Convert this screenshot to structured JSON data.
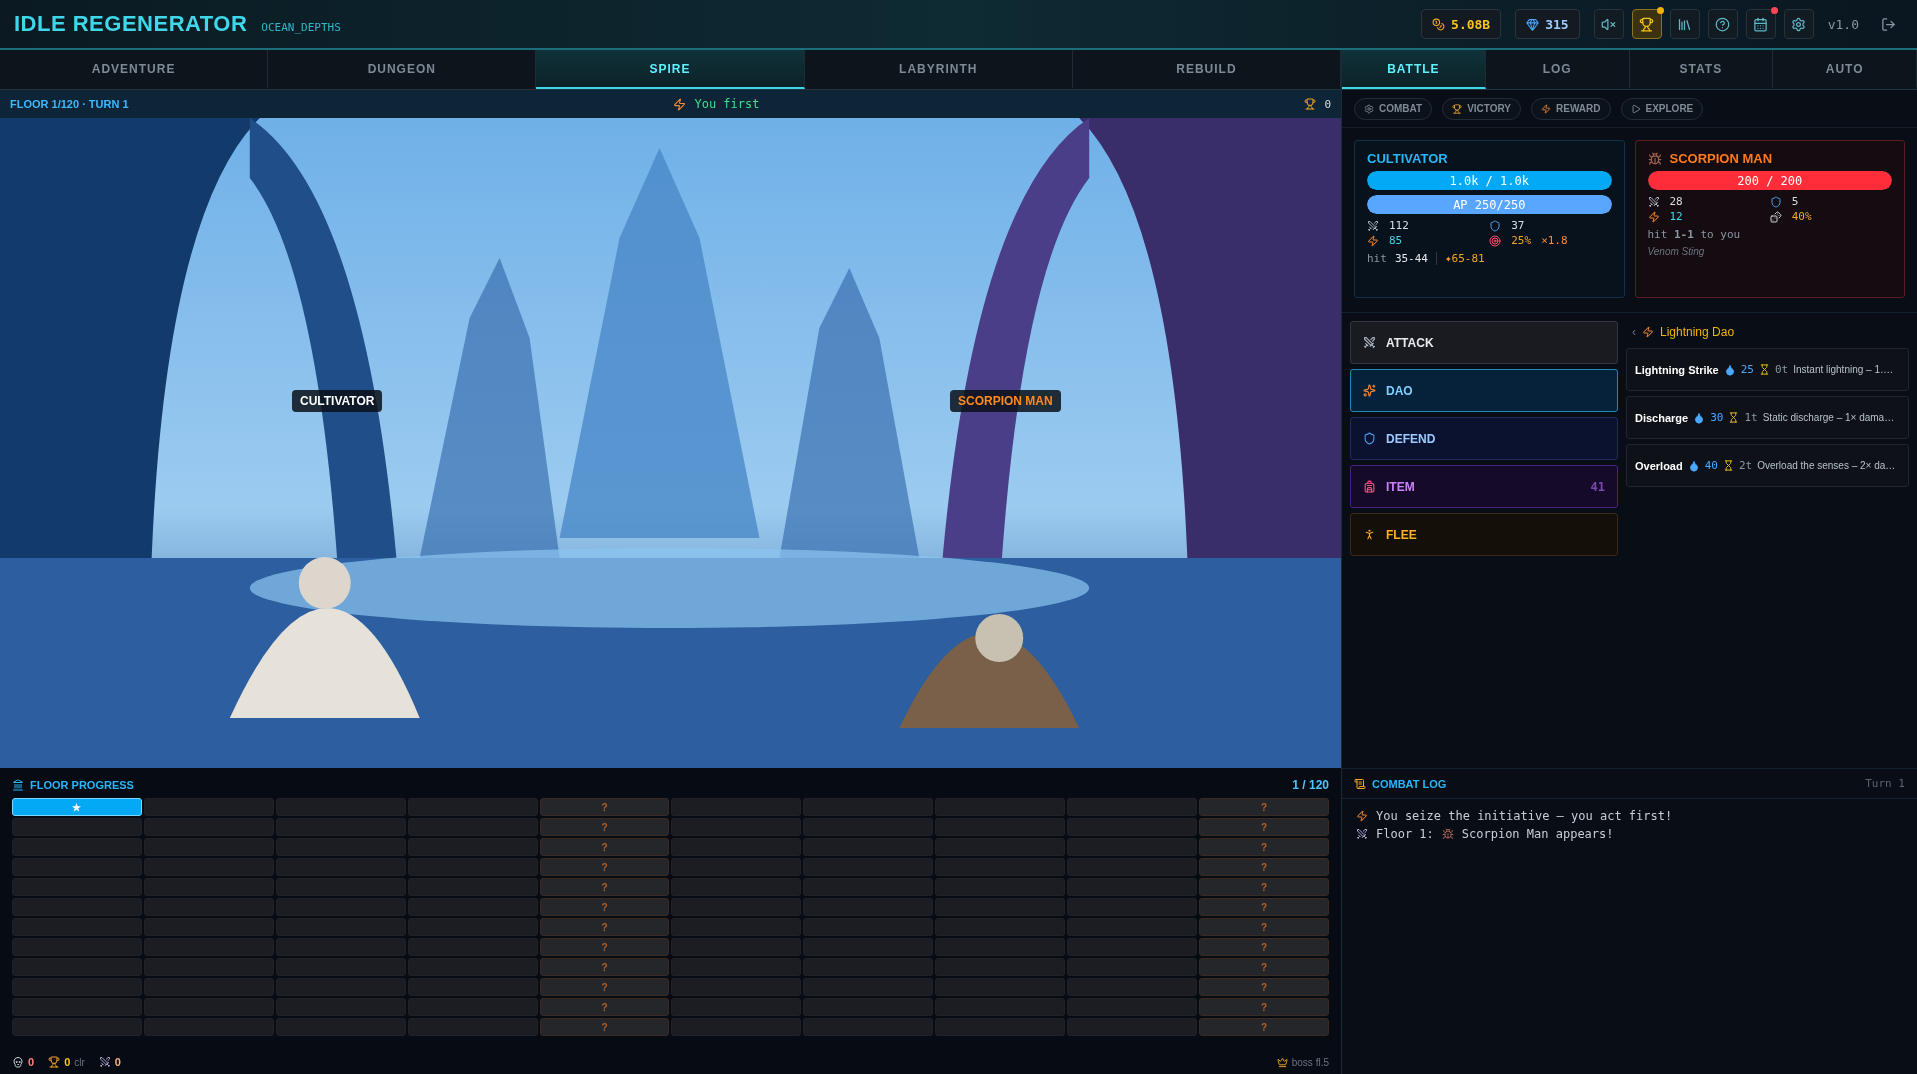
{
  "app": {
    "title": "IDLE REGENERATOR",
    "subtitle": "OCEAN_DEPTHS",
    "version": "v1.0"
  },
  "currencies": [
    {
      "kind": "gold",
      "value": "5.08B"
    },
    {
      "kind": "gem",
      "value": "315"
    }
  ],
  "toolbar": [
    {
      "kind": "mute",
      "selected": false
    },
    {
      "kind": "trophy",
      "selected": true,
      "color": "#f5b000"
    },
    {
      "kind": "library",
      "selected": false
    },
    {
      "kind": "help",
      "selected": false
    },
    {
      "kind": "calendar",
      "selected": false,
      "color": "#ff4455"
    },
    {
      "kind": "settings",
      "selected": false
    }
  ],
  "main_tabs": [
    {
      "label": "ADVENTURE",
      "selected": false
    },
    {
      "label": "DUNGEON",
      "selected": false
    },
    {
      "label": "SPIRE",
      "selected": true
    },
    {
      "label": "LABYRINTH",
      "selected": false
    },
    {
      "label": "REBUILD",
      "selected": false
    }
  ],
  "side_tabs": [
    {
      "label": "BATTLE",
      "selected": true
    },
    {
      "label": "LOG",
      "selected": false
    },
    {
      "label": "STATS",
      "selected": false
    },
    {
      "label": "AUTO",
      "selected": false
    }
  ],
  "scene": {
    "floor_label": "FLOOR 1/120 · TURN 1",
    "initiative": "You first",
    "trophies": "0",
    "fighters": [
      {
        "name": "CULTIVATOR",
        "kind": "ally"
      },
      {
        "name": "SCORPION MAN",
        "kind": "enemy"
      }
    ]
  },
  "filters": [
    {
      "kind": "combat",
      "label": "COMBAT"
    },
    {
      "kind": "victory",
      "label": "VICTORY"
    },
    {
      "kind": "reward",
      "label": "REWARD"
    },
    {
      "kind": "explore",
      "label": "EXPLORE"
    }
  ],
  "player": {
    "name": "CULTIVATOR",
    "hp": {
      "text": "1.0k / 1.0k",
      "level": 1
    },
    "ap": {
      "text": "AP 250/250",
      "level": 1
    },
    "stats": [
      {
        "kind": "attack",
        "value": "112"
      },
      {
        "kind": "defense",
        "value": "37"
      },
      {
        "kind": "speed",
        "value": "85"
      },
      {
        "kind": "crit",
        "value": "25%",
        "extra": "×1.8"
      }
    ],
    "hit_label": "hit",
    "hit": "35-44",
    "special": "✦65-81"
  },
  "enemy": {
    "name": "SCORPION MAN",
    "hp": {
      "text": "200 / 200",
      "level": 1
    },
    "stats": [
      {
        "kind": "attack",
        "value": "28"
      },
      {
        "kind": "defense",
        "value": "5"
      },
      {
        "kind": "speed",
        "value": "12"
      },
      {
        "kind": "dodge",
        "value": "40%"
      }
    ],
    "hit_text": "hit **1-1** to you",
    "ability": "Venom Sting"
  },
  "actions": [
    {
      "kind": "attack",
      "label": "ATTACK",
      "selected": false
    },
    {
      "kind": "dao",
      "label": "DAO",
      "selected": true
    },
    {
      "kind": "defend",
      "label": "DEFEND",
      "selected": false
    },
    {
      "kind": "item",
      "label": "ITEM",
      "selected": false,
      "count": "41"
    },
    {
      "kind": "flee",
      "label": "FLEE",
      "selected": false
    }
  ],
  "skills": {
    "back": "‹",
    "title": "Lightning Dao",
    "items": [
      {
        "name": "Lightning Strike",
        "cost": "25",
        "cooldown": "0t",
        "desc": "Instant lightning – 1…."
      },
      {
        "name": "Discharge",
        "cost": "30",
        "cooldown": "1t",
        "desc": "Static discharge – 1× dama…"
      },
      {
        "name": "Overload",
        "cost": "40",
        "cooldown": "2t",
        "desc": "Overload the senses – 2× da…"
      }
    ]
  },
  "progress": {
    "title": "FLOOR PROGRESS",
    "count": "1 / 120",
    "cells": [
      {
        "kind": "current",
        "label": "★"
      },
      {
        "kind": "plain"
      },
      {
        "kind": "plain"
      },
      {
        "kind": "plain"
      },
      {
        "kind": "boss",
        "label": "?"
      },
      {
        "kind": "plain"
      },
      {
        "kind": "plain"
      },
      {
        "kind": "plain"
      },
      {
        "kind": "plain"
      },
      {
        "kind": "boss",
        "label": "?"
      },
      {
        "kind": "plain"
      },
      {
        "kind": "plain"
      },
      {
        "kind": "plain"
      },
      {
        "kind": "plain"
      },
      {
        "kind": "boss",
        "label": "?"
      },
      {
        "kind": "plain"
      },
      {
        "kind": "plain"
      },
      {
        "kind": "plain"
      },
      {
        "kind": "plain"
      },
      {
        "kind": "boss",
        "label": "?"
      },
      {
        "kind": "plain"
      },
      {
        "kind": "plain"
      },
      {
        "kind": "plain"
      },
      {
        "kind": "plain"
      },
      {
        "kind": "boss",
        "label": "?"
      },
      {
        "kind": "plain"
      },
      {
        "kind": "plain"
      },
      {
        "kind": "plain"
      },
      {
        "kind": "plain"
      },
      {
        "kind": "boss",
        "label": "?"
      },
      {
        "kind": "plain"
      },
      {
        "kind": "plain"
      },
      {
        "kind": "plain"
      },
      {
        "kind": "plain"
      },
      {
        "kind": "boss",
        "label": "?"
      },
      {
        "kind": "plain"
      },
      {
        "kind": "plain"
      },
      {
        "kind": "plain"
      },
      {
        "kind": "plain"
      },
      {
        "kind": "boss",
        "label": "?"
      },
      {
        "kind": "plain"
      },
      {
        "kind": "plain"
      },
      {
        "kind": "plain"
      },
      {
        "kind": "plain"
      },
      {
        "kind": "boss",
        "label": "?"
      },
      {
        "kind": "plain"
      },
      {
        "kind": "plain"
      },
      {
        "kind": "plain"
      },
      {
        "kind": "plain"
      },
      {
        "kind": "boss",
        "label": "?"
      },
      {
        "kind": "plain"
      },
      {
        "kind": "plain"
      },
      {
        "kind": "plain"
      },
      {
        "kind": "plain"
      },
      {
        "kind": "boss",
        "label": "?"
      },
      {
        "kind": "plain"
      },
      {
        "kind": "plain"
      },
      {
        "kind": "plain"
      },
      {
        "kind": "plain"
      },
      {
        "kind": "boss",
        "label": "?"
      },
      {
        "kind": "plain"
      },
      {
        "kind": "plain"
      },
      {
        "kind": "plain"
      },
      {
        "kind": "plain"
      },
      {
        "kind": "boss",
        "label": "?"
      },
      {
        "kind": "plain"
      },
      {
        "kind": "plain"
      },
      {
        "kind": "plain"
      },
      {
        "kind": "plain"
      },
      {
        "kind": "boss",
        "label": "?"
      },
      {
        "kind": "plain"
      },
      {
        "kind": "plain"
      },
      {
        "kind": "plain"
      },
      {
        "kind": "plain"
      },
      {
        "kind": "boss",
        "label": "?"
      },
      {
        "kind": "plain"
      },
      {
        "kind": "plain"
      },
      {
        "kind": "plain"
      },
      {
        "kind": "plain"
      },
      {
        "kind": "boss",
        "label": "?"
      },
      {
        "kind": "plain"
      },
      {
        "kind": "plain"
      },
      {
        "kind": "plain"
      },
      {
        "kind": "plain"
      },
      {
        "kind": "boss",
        "label": "?"
      },
      {
        "kind": "plain"
      },
      {
        "kind": "plain"
      },
      {
        "kind": "plain"
      },
      {
        "kind": "plain"
      },
      {
        "kind": "boss",
        "label": "?"
      },
      {
        "kind": "plain"
      },
      {
        "kind": "plain"
      },
      {
        "kind": "plain"
      },
      {
        "kind": "plain"
      },
      {
        "kind": "boss",
        "label": "?"
      },
      {
        "kind": "plain"
      },
      {
        "kind": "plain"
      },
      {
        "kind": "plain"
      },
      {
        "kind": "plain"
      },
      {
        "kind": "boss",
        "label": "?"
      },
      {
        "kind": "plain"
      },
      {
        "kind": "plain"
      },
      {
        "kind": "plain"
      },
      {
        "kind": "plain"
      },
      {
        "kind": "boss",
        "label": "?"
      },
      {
        "kind": "plain"
      },
      {
        "kind": "plain"
      },
      {
        "kind": "plain"
      },
      {
        "kind": "plain"
      },
      {
        "kind": "boss",
        "label": "?"
      },
      {
        "kind": "plain"
      },
      {
        "kind": "plain"
      },
      {
        "kind": "plain"
      },
      {
        "kind": "plain"
      },
      {
        "kind": "boss",
        "label": "?"
      },
      {
        "kind": "plain"
      },
      {
        "kind": "plain"
      },
      {
        "kind": "plain"
      },
      {
        "kind": "plain"
      },
      {
        "kind": "boss",
        "label": "?"
      }
    ],
    "footer": [
      {
        "kind": "deaths",
        "value": "0"
      },
      {
        "kind": "clears",
        "value": "0",
        "suffix": "clr"
      },
      {
        "kind": "kills",
        "value": "0"
      }
    ],
    "boss_note": "boss fl.5"
  },
  "log": {
    "title": "COMBAT LOG",
    "turn": "Turn 1",
    "entries": [
      {
        "kind": "initiative",
        "text": "You seize the initiative – you act first!"
      },
      {
        "kind": "encounter",
        "text": "Floor 1:",
        "after": "Scorpion Man appears!"
      }
    ]
  }
}
